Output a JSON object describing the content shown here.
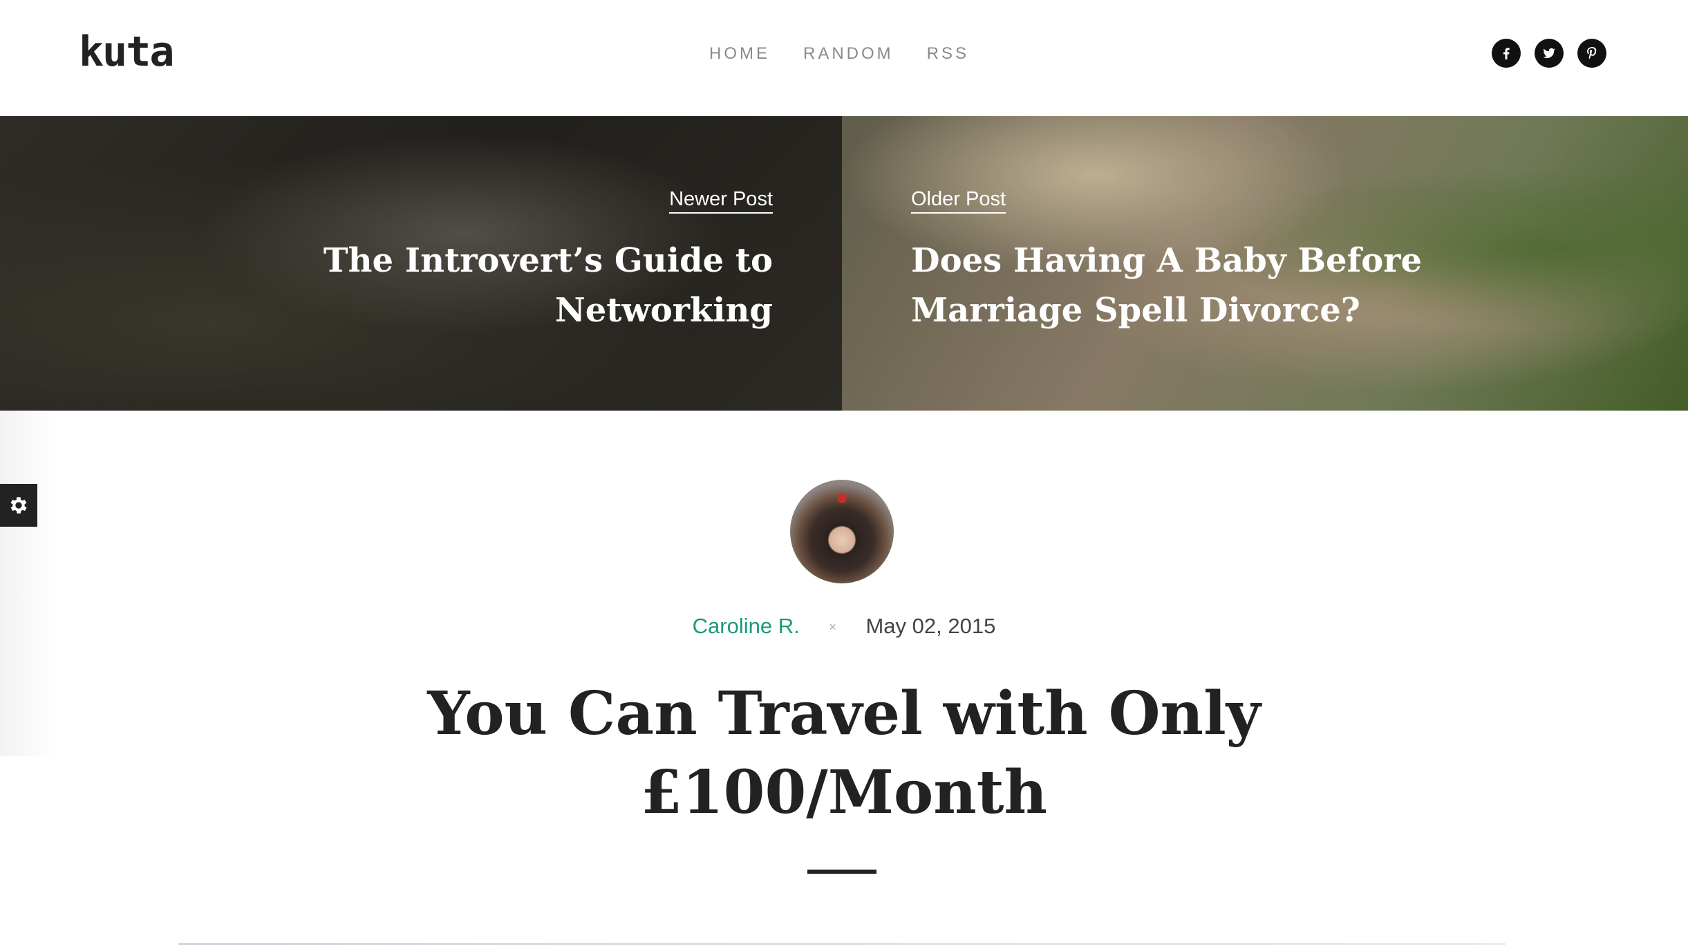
{
  "header": {
    "logo": "kuta",
    "nav": [
      {
        "label": "HOME"
      },
      {
        "label": "RANDOM"
      },
      {
        "label": "RSS"
      }
    ],
    "social_icons": [
      "facebook-icon",
      "twitter-icon",
      "pinterest-icon"
    ]
  },
  "hero": {
    "newer": {
      "kicker": "Newer Post",
      "title": "The Introvert’s Guide to Networking"
    },
    "older": {
      "kicker": "Older Post",
      "title": "Does Having A Baby Before Marriage Spell Divorce?"
    }
  },
  "post": {
    "author": "Caroline R.",
    "separator": "×",
    "date": "May 02, 2015",
    "title": "You Can Travel with Only £100/Month"
  },
  "colors": {
    "accent": "#1a9a7a",
    "text": "#222222",
    "nav": "#8a8a8a"
  }
}
